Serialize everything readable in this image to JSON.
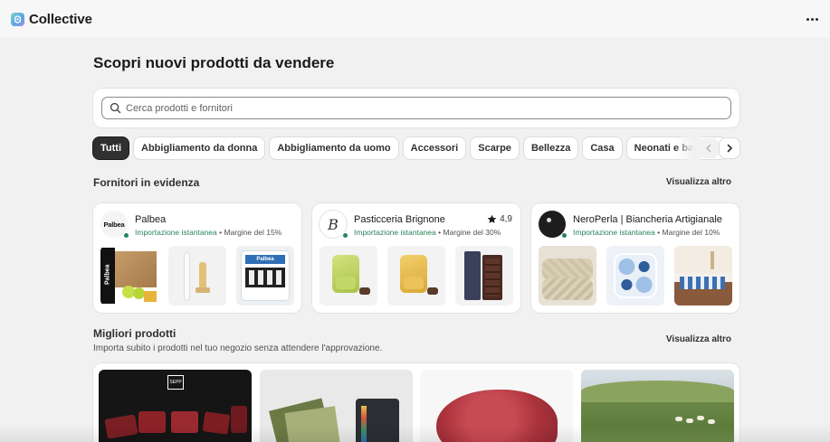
{
  "app": {
    "title": "Collective"
  },
  "page": {
    "title": "Scopri nuovi prodotti da vendere"
  },
  "search": {
    "placeholder": "Cerca prodotti e fornitori",
    "value": ""
  },
  "categories": [
    "Tutti",
    "Abbigliamento da donna",
    "Abbigliamento da uomo",
    "Accessori",
    "Scarpe",
    "Bellezza",
    "Casa",
    "Neonati e bambini"
  ],
  "featured": {
    "title": "Fornitori in evidenza",
    "view_more": "Visualizza altro",
    "suppliers": [
      {
        "name": "Palbea",
        "import_label": "Importazione istantanea",
        "margin": "• Margine del 15%",
        "logo_text": "Palbea",
        "rating": ""
      },
      {
        "name": "Pasticceria Brignone",
        "import_label": "Importazione istantanea",
        "margin": "• Margine del 30%",
        "logo_text": "B",
        "rating": "4,9"
      },
      {
        "name": "NeroPerla | Biancheria Artigianale",
        "import_label": "Importazione istantanea",
        "margin": "• Margine del 10%",
        "logo_text": "",
        "rating": ""
      }
    ]
  },
  "best": {
    "title": "Migliori prodotti",
    "subtitle": "Importa subito i prodotti nel tuo negozio senza attendere l'approvazione.",
    "view_more": "Visualizza altro",
    "product_badge": "SEPP"
  },
  "colors": {
    "accent_green": "#29845a",
    "chip_active": "#303030",
    "background": "#f1f1f1"
  },
  "icons": [
    "collective-logo-icon",
    "more-icon",
    "search-icon",
    "chevron-left-icon",
    "chevron-right-icon",
    "star-icon"
  ]
}
